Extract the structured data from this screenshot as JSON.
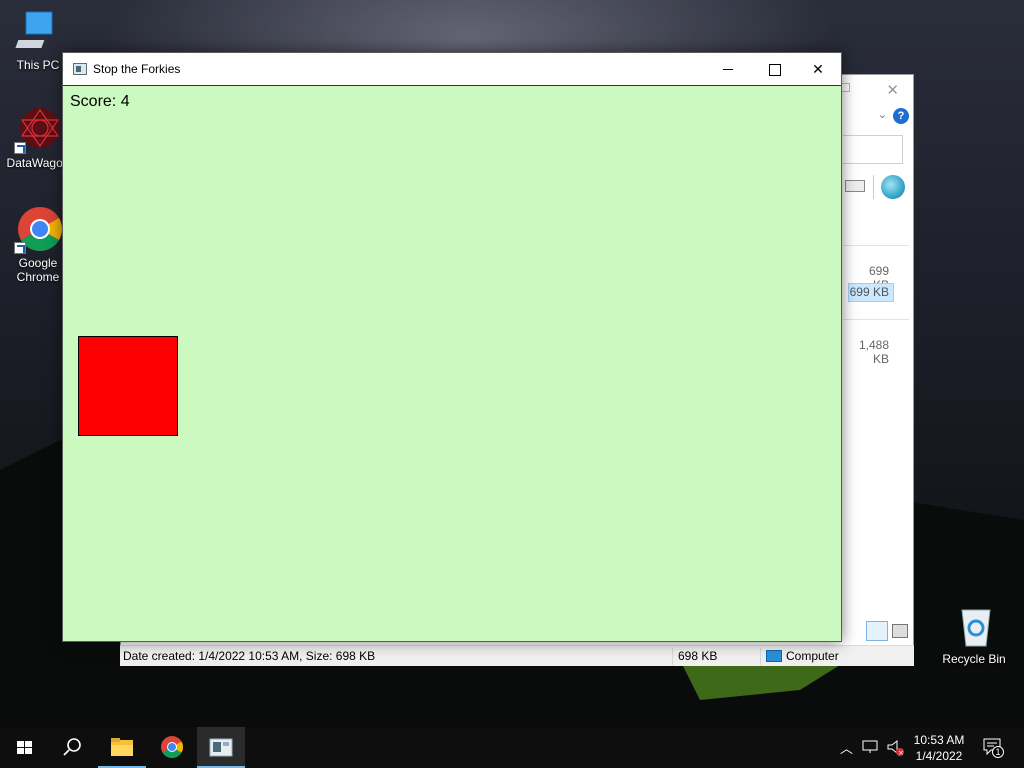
{
  "desktop": {
    "icons": [
      {
        "label": "This PC"
      },
      {
        "label": "DataWagon"
      },
      {
        "label": "Google Chrome"
      },
      {
        "label": "Recycle Bin"
      }
    ]
  },
  "explorer": {
    "sizes": [
      "699 KB",
      "699 KB",
      "1,488 KB"
    ],
    "status": {
      "details": "Date created: 1/4/2022 10:53 AM, Size: 698 KB",
      "size": "698 KB",
      "location": "Computer"
    }
  },
  "game_window": {
    "title": "Stop the Forkies",
    "score_text": "Score: 4",
    "colors": {
      "background": "#cbf9c0",
      "forkie": "#ff0000"
    }
  },
  "taskbar": {
    "icons": [
      "windows-start-icon",
      "search-icon",
      "file-explorer-icon",
      "chrome-icon",
      "game-app-icon"
    ],
    "time": "10:53 AM",
    "date": "1/4/2022",
    "notification_count": "1"
  }
}
